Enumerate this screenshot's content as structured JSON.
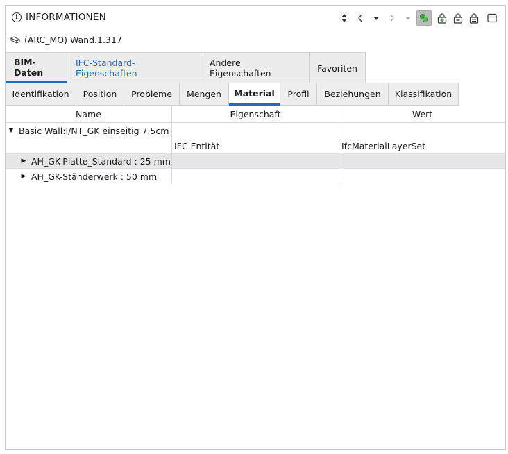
{
  "header": {
    "title": "INFORMATIONEN",
    "object_label": "(ARC_MO) Wand.1.317"
  },
  "toolbar": {
    "icons": [
      "sort-updown-icon",
      "chevron-left-icon",
      "caret-down-icon",
      "chevron-right-icon",
      "caret-down-icon",
      "highlight-link-icon",
      "lock-add-icon",
      "lock-remove-icon",
      "lock-icon",
      "panel-icon"
    ]
  },
  "tabs_primary": [
    {
      "label": "BIM-Daten"
    },
    {
      "label": "IFC-Standard-Eigenschaften"
    },
    {
      "label": "Andere Eigenschaften"
    },
    {
      "label": "Favoriten"
    }
  ],
  "tabs_secondary": [
    {
      "label": "Identifikation"
    },
    {
      "label": "Position"
    },
    {
      "label": "Probleme"
    },
    {
      "label": "Mengen"
    },
    {
      "label": "Material"
    },
    {
      "label": "Profil"
    },
    {
      "label": "Beziehungen"
    },
    {
      "label": "Klassifikation"
    }
  ],
  "table": {
    "columns": [
      "Name",
      "Eigenschaft",
      "Wert"
    ],
    "rows": [
      {
        "name": "Basic Wall:I/NT_GK einseitig 7.5cm",
        "property": "",
        "value": ""
      },
      {
        "name": "",
        "property": "IFC Entität",
        "value": "IfcMaterialLayerSet"
      },
      {
        "name": "AH_GK-Platte_Standard : 25 mm",
        "property": "",
        "value": ""
      },
      {
        "name": "AH_GK-Ständerwerk : 50 mm",
        "property": "",
        "value": ""
      }
    ]
  },
  "colors": {
    "accent": "#1a6cc4",
    "tab_bg": "#ececec",
    "row_shade": "#e6e6e9"
  }
}
